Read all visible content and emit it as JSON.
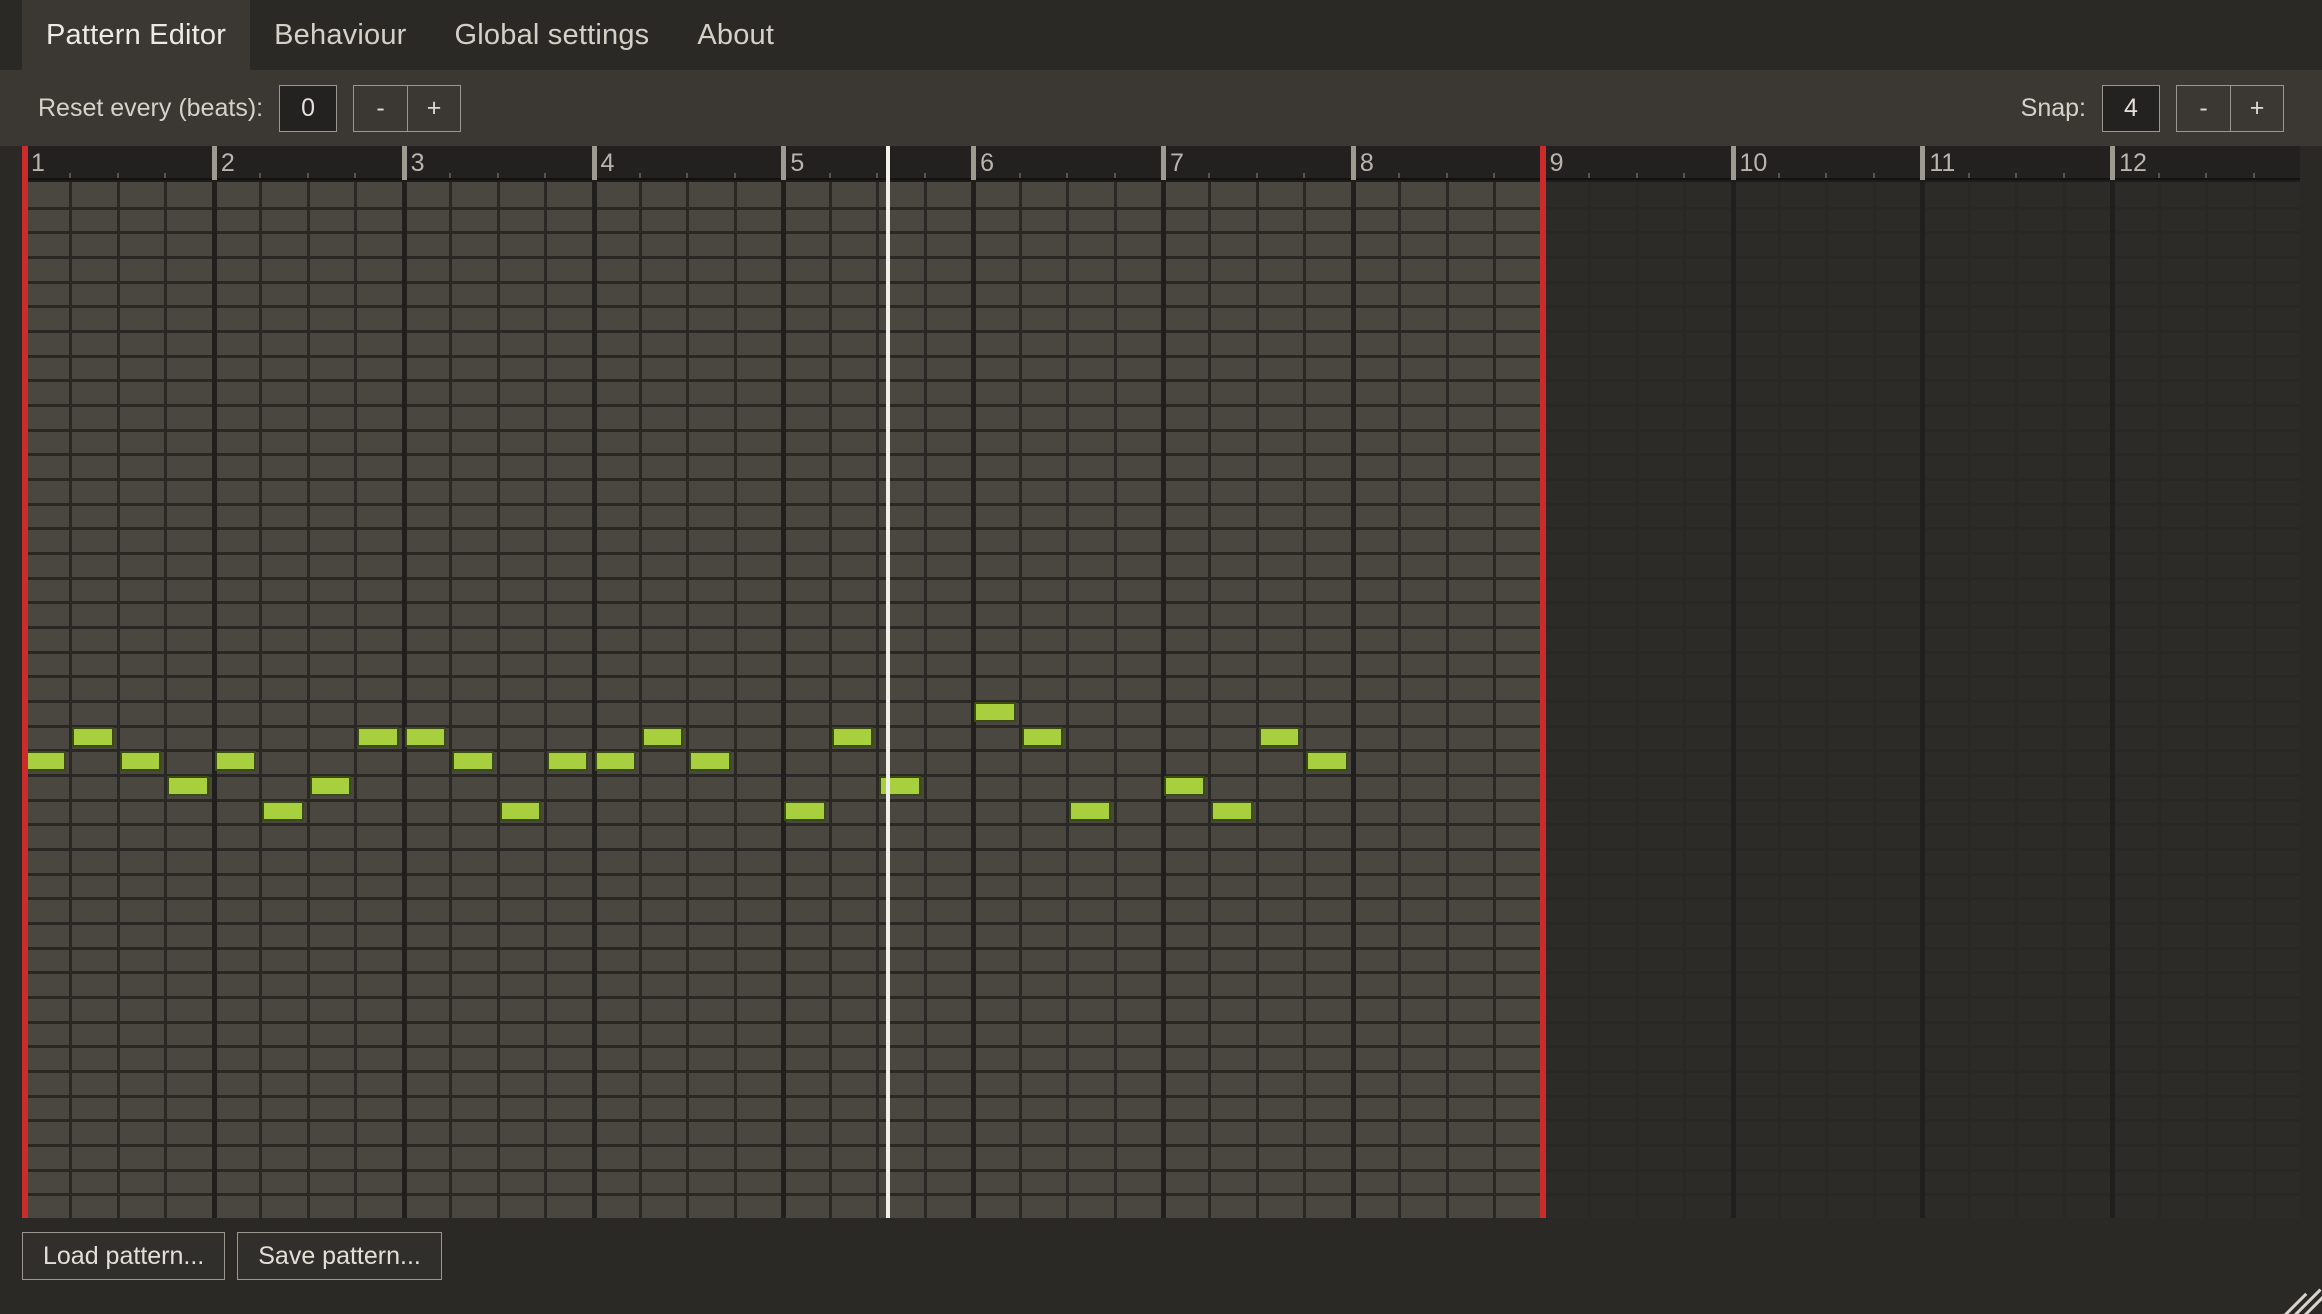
{
  "window": {
    "title": "Pattern Editor",
    "background": "#2b2925"
  },
  "tabs": [
    {
      "label": "Pattern Editor",
      "active": true
    },
    {
      "label": "Behaviour",
      "active": false
    },
    {
      "label": "Global settings",
      "active": false
    },
    {
      "label": "About",
      "active": false
    }
  ],
  "toolbar": {
    "reset": {
      "label": "Reset every (beats):",
      "value": "0",
      "minus_label": "-",
      "plus_label": "+"
    },
    "snap": {
      "label": "Snap:",
      "value": "4",
      "minus_label": "-",
      "plus_label": "+"
    }
  },
  "grid": {
    "bars": [
      "1",
      "2",
      "3",
      "4",
      "5",
      "6",
      "7",
      "8",
      "9",
      "10",
      "11",
      "12"
    ],
    "total_bars": 12,
    "beats_per_bar": 4,
    "rows": 42,
    "active_bars": 8,
    "loop_start_bar": 1,
    "loop_end_bar": 9,
    "playhead_bar_position": 5.55,
    "colors": {
      "note": "#a8cf3d",
      "note_border": "#3c4a14",
      "active_cell": "#4a4740",
      "inactive_cell": "#2d2b28",
      "gridline": "#2a2825",
      "barline": "#201f1d",
      "loop_marker": "#cc2b2b",
      "playhead": "#f2f0ea",
      "ruler_bg": "#232120"
    }
  },
  "notes": [
    {
      "bar": 1,
      "beat": 0,
      "row": 23
    },
    {
      "bar": 1,
      "beat": 1,
      "row": 22
    },
    {
      "bar": 1,
      "beat": 2,
      "row": 23
    },
    {
      "bar": 1,
      "beat": 3,
      "row": 24
    },
    {
      "bar": 2,
      "beat": 0,
      "row": 23
    },
    {
      "bar": 2,
      "beat": 1,
      "row": 25
    },
    {
      "bar": 2,
      "beat": 2,
      "row": 24
    },
    {
      "bar": 2,
      "beat": 3,
      "row": 22
    },
    {
      "bar": 3,
      "beat": 0,
      "row": 22
    },
    {
      "bar": 3,
      "beat": 1,
      "row": 23
    },
    {
      "bar": 3,
      "beat": 2,
      "row": 25
    },
    {
      "bar": 3,
      "beat": 3,
      "row": 23
    },
    {
      "bar": 4,
      "beat": 0,
      "row": 23
    },
    {
      "bar": 4,
      "beat": 1,
      "row": 22
    },
    {
      "bar": 4,
      "beat": 2,
      "row": 23
    },
    {
      "bar": 5,
      "beat": 0,
      "row": 25
    },
    {
      "bar": 5,
      "beat": 1,
      "row": 22
    },
    {
      "bar": 5,
      "beat": 2,
      "row": 24
    },
    {
      "bar": 6,
      "beat": 0,
      "row": 21
    },
    {
      "bar": 6,
      "beat": 1,
      "row": 22
    },
    {
      "bar": 6,
      "beat": 2,
      "row": 25
    },
    {
      "bar": 7,
      "beat": 0,
      "row": 24
    },
    {
      "bar": 7,
      "beat": 1,
      "row": 25
    },
    {
      "bar": 7,
      "beat": 2,
      "row": 22
    },
    {
      "bar": 7,
      "beat": 3,
      "row": 23
    }
  ],
  "bottom": {
    "load_label": "Load pattern...",
    "save_label": "Save pattern..."
  },
  "icons": {
    "resize": "resize-grip-icon"
  }
}
